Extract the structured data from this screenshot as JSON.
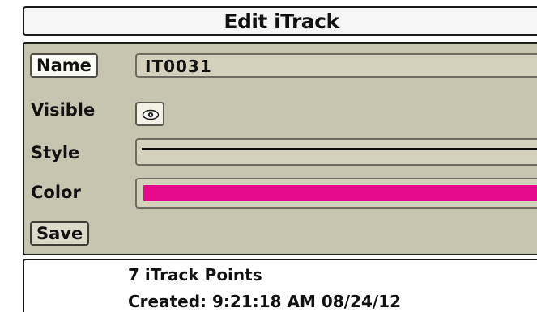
{
  "window": {
    "title": "Edit iTrack"
  },
  "form": {
    "name_label": "Name",
    "name_value": "IT0031",
    "visible_label": "Visible",
    "visible_icon": "eye-icon",
    "style_label": "Style",
    "style_value": "solid-line",
    "color_label": "Color",
    "color_value": "#e60a8c",
    "save_label": "Save"
  },
  "info": {
    "points": "7 iTrack Points",
    "created": "Created: 9:21:18 AM 08/24/12"
  },
  "colors": {
    "panel_bg": "#c6c5b0",
    "field_bg": "#d4d2bd",
    "track_color": "#e60a8c"
  }
}
